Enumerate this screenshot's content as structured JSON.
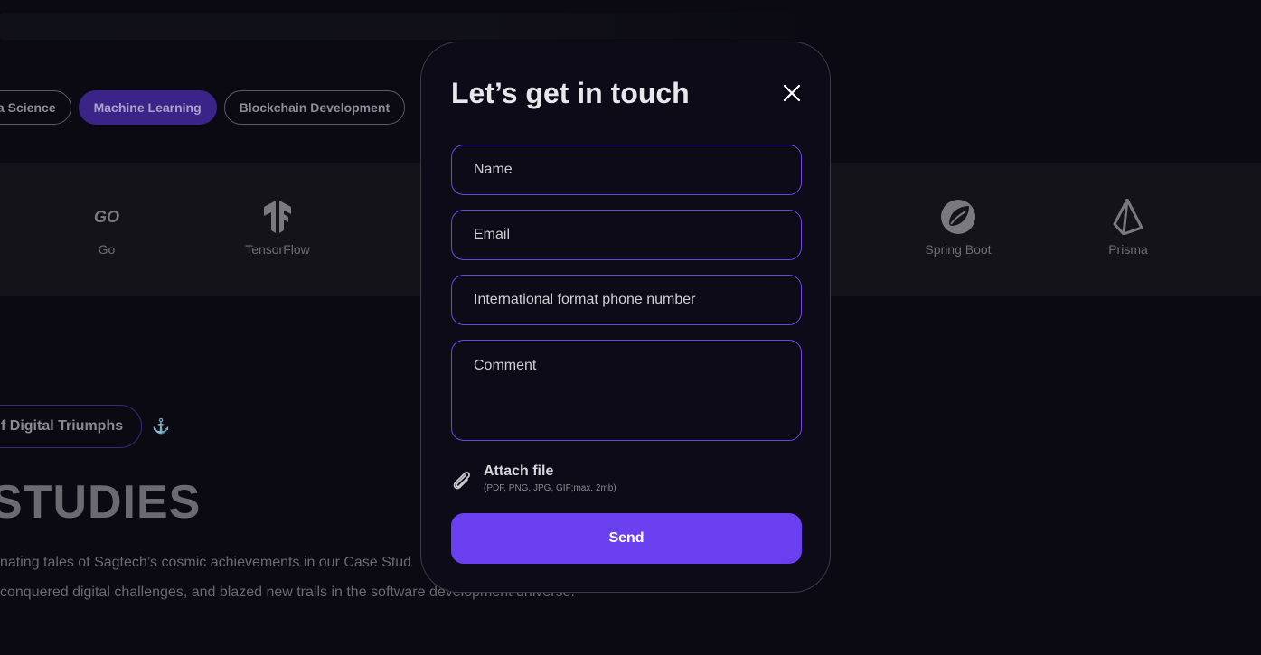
{
  "background": {
    "chips": [
      "a Science",
      "Machine Learning",
      "Blockchain Development"
    ],
    "tech": [
      {
        "label": "Go",
        "icon": "go-logo-icon"
      },
      {
        "label": "TensorFlow",
        "icon": "tensorflow-logo-icon"
      },
      {
        "label": "Spring Boot",
        "icon": "spring-boot-logo-icon"
      },
      {
        "label": "Prisma",
        "icon": "prisma-logo-icon"
      }
    ],
    "go_logo_text": "GO",
    "pill": "f Digital Triumphs",
    "heading": "STUDIES",
    "paragraph_line1": "nating tales of Sagtech’s cosmic achievements in our Case Stud",
    "paragraph_line2": "conquered digital challenges, and blazed new trails in the software development universe."
  },
  "modal": {
    "title": "Let’s get in touch",
    "fields": {
      "name_placeholder": "Name",
      "email_placeholder": "Email",
      "phone_placeholder": "International format phone number",
      "comment_placeholder": "Comment"
    },
    "attach": {
      "label": "Attach file",
      "hint": "(PDF, PNG, JPG, GIF;max. 2mb)",
      "icon": "paperclip-icon"
    },
    "send_label": "Send",
    "accent_color": "#6a3ff0"
  }
}
